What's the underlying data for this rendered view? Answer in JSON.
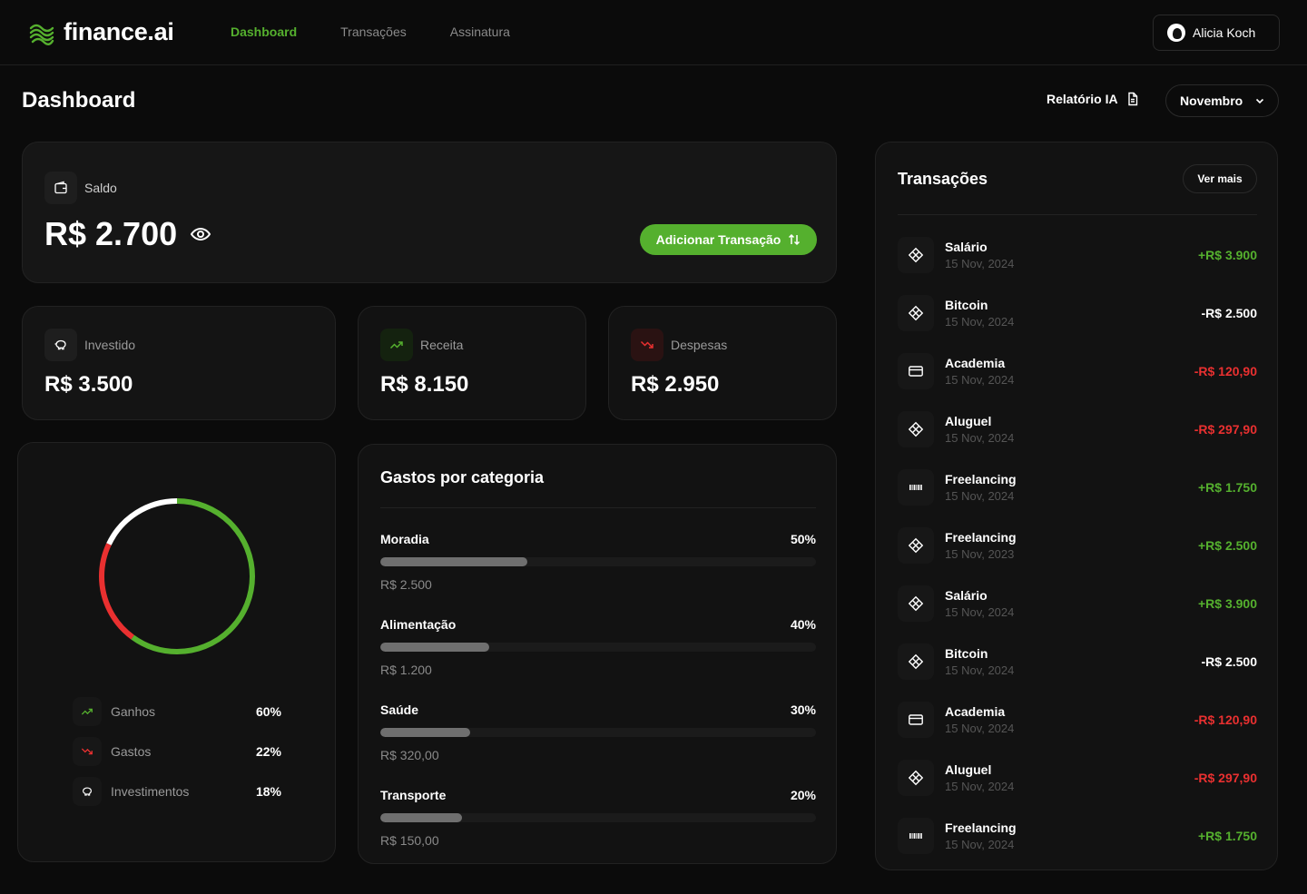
{
  "header": {
    "logo": "finance.ai",
    "nav": [
      {
        "label": "Dashboard",
        "active": true
      },
      {
        "label": "Transações",
        "active": false
      },
      {
        "label": "Assinatura",
        "active": false
      }
    ],
    "user": "Alicia Koch"
  },
  "page": {
    "title": "Dashboard",
    "report_label": "Relatório IA",
    "month": "Novembro"
  },
  "saldo": {
    "label": "Saldo",
    "value": "R$ 2.700",
    "add_button": "Adicionar Transação"
  },
  "summary": [
    {
      "label": "Investido",
      "value": "R$ 3.500",
      "icon": "piggy-bank-icon"
    },
    {
      "label": "Receita",
      "value": "R$ 8.150",
      "icon": "trending-up-icon"
    },
    {
      "label": "Despesas",
      "value": "R$ 2.950",
      "icon": "trending-down-icon"
    }
  ],
  "donut": {
    "segments": [
      {
        "name": "Ganhos",
        "value": 60,
        "color": "#55b02e"
      },
      {
        "name": "Gastos",
        "value": 22,
        "color": "#e93030"
      },
      {
        "name": "Investimentos",
        "value": 18,
        "color": "#ffffff"
      }
    ],
    "legend": [
      {
        "label": "Ganhos",
        "pct": "60%",
        "icon": "trending-up-icon"
      },
      {
        "label": "Gastos",
        "pct": "22%",
        "icon": "trending-down-icon"
      },
      {
        "label": "Investimentos",
        "pct": "18%",
        "icon": "piggy-bank-icon"
      }
    ]
  },
  "categories": {
    "title": "Gastos por categoria",
    "items": [
      {
        "name": "Moradia",
        "pct": "50%",
        "fill": 0.337,
        "amount": "R$ 2.500"
      },
      {
        "name": "Alimentação",
        "pct": "40%",
        "fill": 0.25,
        "amount": "R$ 1.200"
      },
      {
        "name": "Saúde",
        "pct": "30%",
        "fill": 0.206,
        "amount": "R$ 320,00"
      },
      {
        "name": "Transporte",
        "pct": "20%",
        "fill": 0.188,
        "amount": "R$ 150,00"
      }
    ]
  },
  "transactions": {
    "title": "Transações",
    "see_more": "Ver mais",
    "items": [
      {
        "name": "Salário",
        "date": "15 Nov, 2024",
        "amount": "+R$ 3.900",
        "type": "pos",
        "icon": "pix-icon"
      },
      {
        "name": "Bitcoin",
        "date": "15 Nov, 2024",
        "amount": "-R$ 2.500",
        "type": "neu",
        "icon": "pix-icon"
      },
      {
        "name": "Academia",
        "date": "15 Nov, 2024",
        "amount": "-R$ 120,90",
        "type": "neg",
        "icon": "credit-card-icon"
      },
      {
        "name": "Aluguel",
        "date": "15 Nov, 2024",
        "amount": "-R$ 297,90",
        "type": "neg",
        "icon": "pix-icon"
      },
      {
        "name": "Freelancing",
        "date": "15 Nov, 2024",
        "amount": "+R$ 1.750",
        "type": "pos",
        "icon": "barcode-icon"
      },
      {
        "name": "Freelancing",
        "date": "15 Nov, 2023",
        "amount": "+R$ 2.500",
        "type": "pos",
        "icon": "pix-icon"
      },
      {
        "name": "Salário",
        "date": "15 Nov, 2024",
        "amount": "+R$ 3.900",
        "type": "pos",
        "icon": "pix-icon"
      },
      {
        "name": "Bitcoin",
        "date": "15 Nov, 2024",
        "amount": "-R$ 2.500",
        "type": "neu",
        "icon": "pix-icon"
      },
      {
        "name": "Academia",
        "date": "15 Nov, 2024",
        "amount": "-R$ 120,90",
        "type": "neg",
        "icon": "credit-card-icon"
      },
      {
        "name": "Aluguel",
        "date": "15 Nov, 2024",
        "amount": "-R$ 297,90",
        "type": "neg",
        "icon": "pix-icon"
      },
      {
        "name": "Freelancing",
        "date": "15 Nov, 2024",
        "amount": "+R$ 1.750",
        "type": "pos",
        "icon": "barcode-icon"
      }
    ]
  }
}
